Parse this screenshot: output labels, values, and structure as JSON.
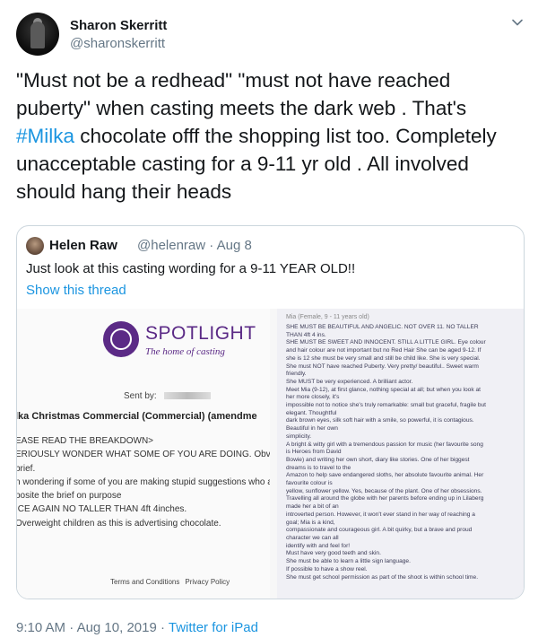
{
  "author": {
    "name": "Sharon Skerritt",
    "handle": "@sharonskerritt"
  },
  "tweet": {
    "text_before": "\"Must not be a redhead\" \"must not have reached puberty\" when casting meets the dark web . That's ",
    "hashtag": "#Milka",
    "text_after": " chocolate offf the shopping list too. Completely unacceptable casting for a 9-11 yr old . All involved should hang their heads"
  },
  "quoted_tweet": {
    "name": "Helen Raw",
    "handle_date": "@helenraw · Aug 8",
    "text": "Just look at this casting wording for a 9-11 YEAR OLD!!",
    "show_thread": "Show this thread",
    "attachment": {
      "left": {
        "logo_title": "SPOTLIGHT",
        "logo_subtitle": "The home of casting",
        "sent_by": "Sent by:",
        "commercial_title": "lka Christmas Commercial (Commercial) (amendme",
        "lines": [
          "EASE READ THE BREAKDOWN>",
          "ERIOUSLY WONDER WHAT SOME OF YOU ARE DOING. Obvi",
          "brief.",
          "n wondering if some of you are making stupid suggestions who a",
          "posite the brief on purpose",
          "ICE AGAIN NO TALLER THAN 4ft 4inches.",
          " Overweight children as this is advertising chocolate."
        ],
        "footer_terms": "Terms and Conditions",
        "footer_privacy": "Privacy Policy"
      },
      "right": {
        "header": "Mia (Female, 9 - 11 years old)",
        "lines": [
          "SHE MUST BE BEAUTIFUL AND ANGELIC. NOT OVER 11. NO TALLER",
          "THAN 4ft 4 ins.",
          "SHE MUST BE SWEET AND INNOCENT. STILL A LITTLE GIRL. Eye colour",
          "and hair colour are not important but no Red Hair She can be aged 9-12. If",
          "she is 12 she must be very small and still be child like. She is very special.",
          "She must NOT have reached Puberty. Very pretty/ beautiful.. Sweet warm",
          "friendly.",
          "She MUST be very experienced. A brilliant actor.",
          "Meet Mia (9-12), at first glance, nothing special at all; but when you look at",
          "her more closely, it's",
          "impossible not to notice she's truly remarkable: small but graceful, fragile but",
          "elegant. Thoughtful",
          "dark brown eyes, silk soft hair with a smile, so powerful, it is contagious.",
          "Beautiful in her own",
          "simplicity.",
          "A bright & witty girl with a tremendous passion for music (her favourite song",
          "is Heroes from David",
          "Bowie) and writing her own short, diary like stories. One of her biggest",
          "dreams is to travel to the",
          "Amazon to help save endangered sloths, her absolute favourite animal. Her",
          "favourite colour is",
          "yellow, sunflower yellow. Yes, because of the plant. One of her obsessions.",
          "Travelling all around the globe with her parents before ending up in Lilaberg",
          "made her a bit of an",
          "introverted person. However, it won't ever stand in her way of reaching a",
          "goal; Mia is a kind,",
          "compassionate and courageous girl. A bit quirky, but a brave and proud",
          "character we can all",
          "identify with and feel for!",
          "Must have very good teeth and skin.",
          "She must be able to learn a little sign language.",
          "If possible to have a show reel.",
          "She must get school permission as part of the shoot is within school time."
        ]
      }
    }
  },
  "footer": {
    "time": "9:10 AM",
    "separator": " · ",
    "date": "Aug 10, 2019",
    "separator2": " · ",
    "source": "Twitter for iPad"
  },
  "colors": {
    "link": "#1b95e0",
    "secondary_text": "#657786",
    "border": "#ccd6dd",
    "spotlight_purple": "#5b2a86"
  }
}
